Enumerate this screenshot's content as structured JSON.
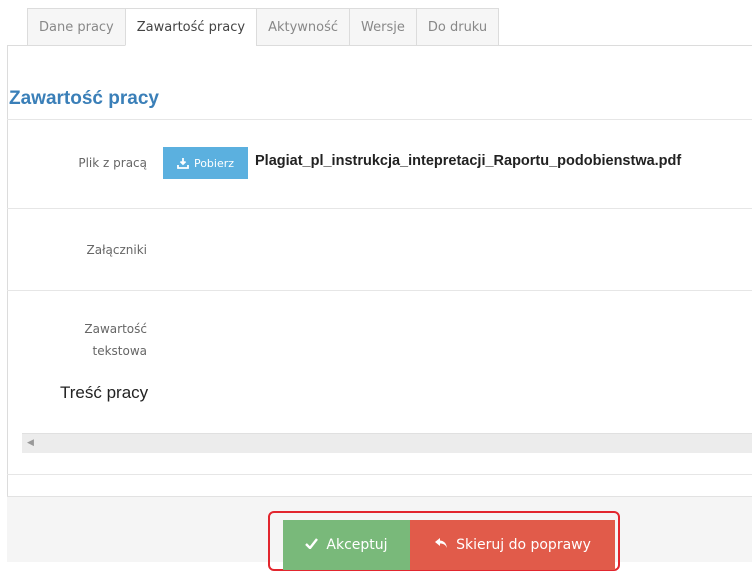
{
  "tabs": [
    {
      "label": "Dane pracy",
      "active": false
    },
    {
      "label": "Zawartość pracy",
      "active": true
    },
    {
      "label": "Aktywność",
      "active": false
    },
    {
      "label": "Wersje",
      "active": false
    },
    {
      "label": "Do druku",
      "active": false
    }
  ],
  "section_title": "Zawartość pracy",
  "file_row": {
    "label": "Plik z pracą",
    "download_label": "Pobierz",
    "download_icon": "download-icon",
    "filename": "Plagiat_pl_instrukcja_intepretacji_Raportu_podobienstwa.pdf"
  },
  "attachments_label": "Załączniki",
  "text_content_label_line1": "Zawartość",
  "text_content_label_line2": "tekstowa",
  "content_heading": "Treść pracy",
  "actions": {
    "accept_label": "Akceptuj",
    "accept_icon": "check-icon",
    "return_label": "Skieruj do poprawy",
    "return_icon": "reply-icon"
  },
  "colors": {
    "title": "#3a7fb8",
    "download_button": "#5bb0df",
    "accept_button": "#79b97a",
    "return_button": "#e15b4a",
    "highlight_frame": "#e2262e"
  }
}
